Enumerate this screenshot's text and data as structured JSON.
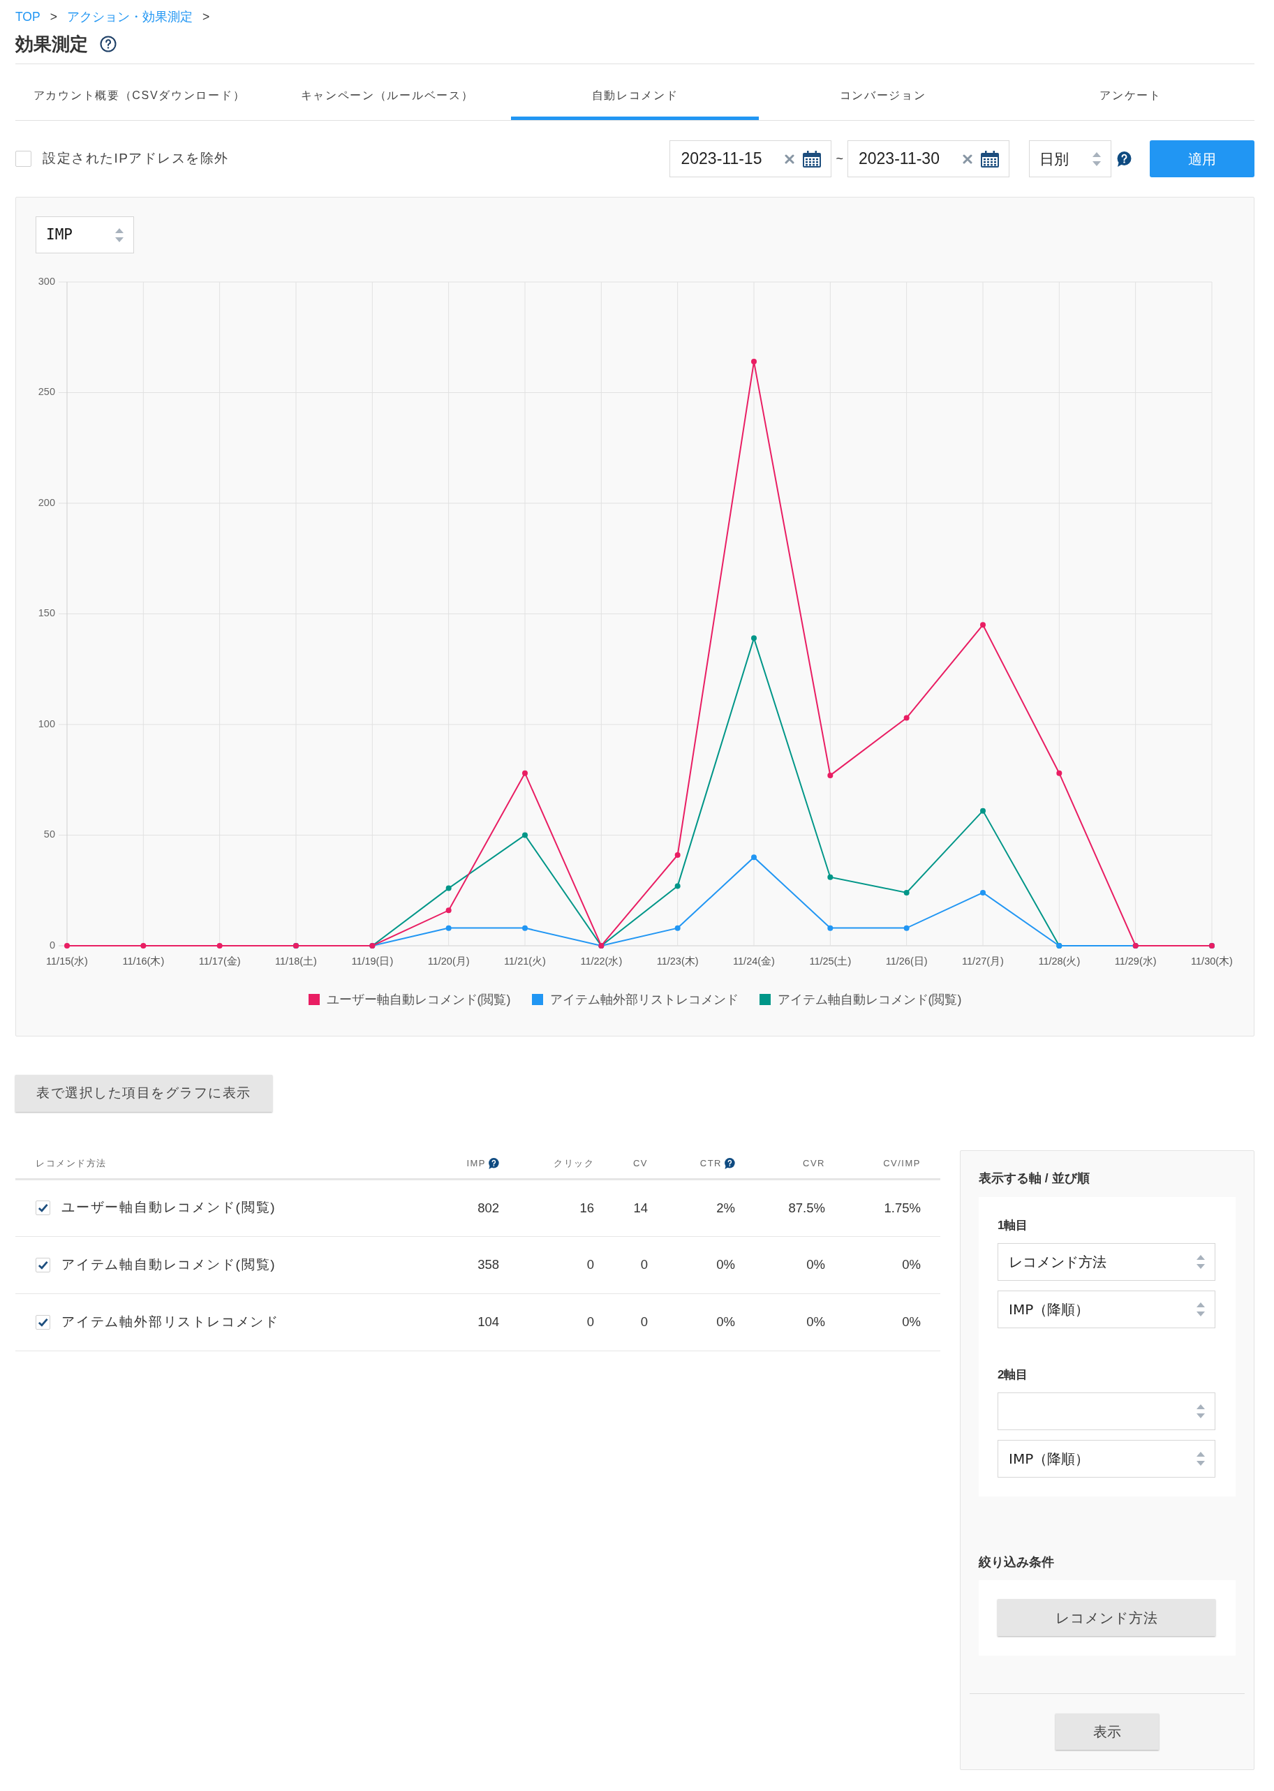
{
  "breadcrumb": [
    {
      "label": "TOP",
      "kind": "link"
    },
    {
      "label": ">",
      "kind": "separator"
    },
    {
      "label": "アクション・効果測定",
      "kind": "link"
    },
    {
      "label": ">",
      "kind": "separator"
    }
  ],
  "page_title": "効果測定",
  "tabs": [
    {
      "label": "アカウント概要（CSVダウンロード）",
      "selected": false
    },
    {
      "label": "キャンペーン（ルールベース）",
      "selected": false
    },
    {
      "label": "自動レコメンド",
      "selected": true
    },
    {
      "label": "コンバージョン",
      "selected": false
    },
    {
      "label": "アンケート",
      "selected": false
    }
  ],
  "filters": {
    "exclude_ip": {
      "label": "設定されたIPアドレスを除外",
      "checked": false
    },
    "date_from": "2023-11-15",
    "date_separator": "~",
    "date_to": "2023-11-30",
    "period": "日別",
    "apply_button": "適用"
  },
  "chart_panel": {
    "metric": "IMP",
    "chart_data": {
      "type": "line",
      "grid": true,
      "legend": "bottom",
      "categories": [
        "11/15(水)",
        "11/16(木)",
        "11/17(金)",
        "11/18(土)",
        "11/19(日)",
        "11/20(月)",
        "11/21(火)",
        "11/22(水)",
        "11/23(木)",
        "11/24(金)",
        "11/25(土)",
        "11/26(日)",
        "11/27(月)",
        "11/28(火)",
        "11/29(水)",
        "11/30(木)"
      ],
      "series": [
        {
          "name": "ユーザー軸自動レコメンド(閲覧)",
          "color": "#e91e63",
          "marker": "circle",
          "values": [
            0,
            0,
            0,
            0,
            0,
            16,
            78,
            0,
            41,
            264,
            77,
            103,
            145,
            78,
            0,
            0
          ]
        },
        {
          "name": "アイテム軸外部リストレコメンド",
          "color": "#2196f3",
          "marker": "circle",
          "values": [
            null,
            null,
            null,
            0,
            0,
            8,
            8,
            0,
            8,
            40,
            8,
            8,
            24,
            0,
            0,
            0
          ]
        },
        {
          "name": "アイテム軸自動レコメンド(閲覧)",
          "color": "#009688",
          "marker": "circle",
          "values": [
            null,
            null,
            null,
            0,
            0,
            26,
            50,
            0,
            27,
            139,
            31,
            24,
            61,
            0,
            0,
            0
          ]
        }
      ],
      "ylim": [
        0,
        300
      ],
      "yticks": [
        0,
        50,
        100,
        150,
        200,
        250,
        300
      ]
    }
  },
  "graph_button": "表で選択した項目をグラフに表示",
  "table": {
    "columns": [
      {
        "label": "レコメンド方法",
        "help": false
      },
      {
        "label": "IMP",
        "help": true
      },
      {
        "label": "クリック",
        "help": false
      },
      {
        "label": "CV",
        "help": false
      },
      {
        "label": "CTR",
        "help": true
      },
      {
        "label": "CVR",
        "help": false
      },
      {
        "label": "CV/IMP",
        "help": false
      }
    ],
    "rows": [
      {
        "checked": true,
        "cells": [
          "ユーザー軸自動レコメンド(閲覧)",
          "802",
          "16",
          "14",
          "2%",
          "87.5%",
          "1.75%"
        ]
      },
      {
        "checked": true,
        "cells": [
          "アイテム軸自動レコメンド(閲覧)",
          "358",
          "0",
          "0",
          "0%",
          "0%",
          "0%"
        ]
      },
      {
        "checked": true,
        "cells": [
          "アイテム軸外部リストレコメンド",
          "104",
          "0",
          "0",
          "0%",
          "0%",
          "0%"
        ]
      }
    ]
  },
  "side_panel": {
    "axis_title": "表示する軸 / 並び順",
    "axes": [
      {
        "label": "1軸目",
        "field": "レコメンド方法",
        "order": "IMP（降順）"
      },
      {
        "label": "2軸目",
        "order": "IMP（降順）"
      }
    ],
    "filter_title": "絞り込み条件",
    "filter_buttons": [
      "レコメンド方法"
    ],
    "submit_button": "表示"
  }
}
